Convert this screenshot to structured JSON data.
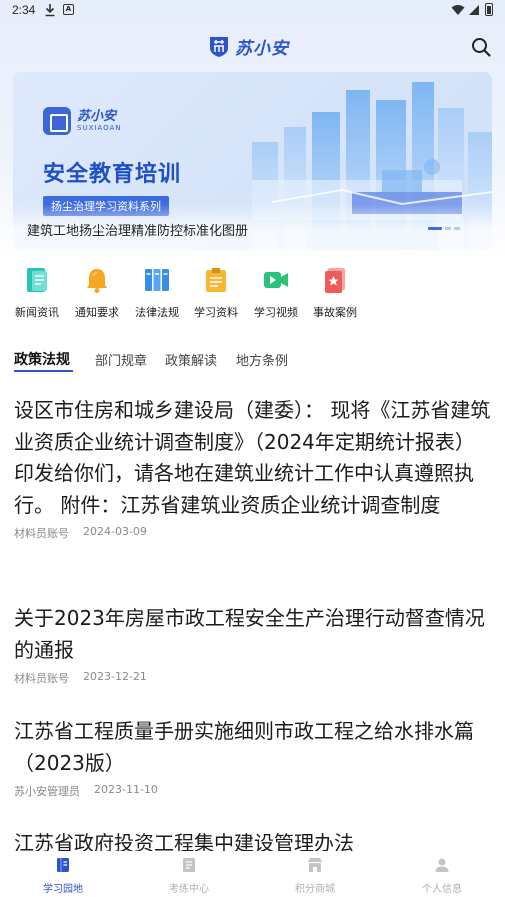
{
  "status_bar": {
    "time": "2:34",
    "a_badge": "A"
  },
  "header": {
    "app_name": "苏小安"
  },
  "banner": {
    "brand_cn": "苏小安",
    "brand_en": "SUXIAOAN",
    "title": "安全教育培训",
    "tag": "扬尘治理学习资料系列",
    "caption": "建筑工地扬尘治理精准防控标准化图册"
  },
  "categories": [
    {
      "label": "新闻资讯",
      "icon": "news-icon",
      "color": "#27c7b8"
    },
    {
      "label": "通知要求",
      "icon": "bell-icon",
      "color": "#f5a623"
    },
    {
      "label": "法律法规",
      "icon": "books-icon",
      "color": "#3a8ee6"
    },
    {
      "label": "学习资料",
      "icon": "clipboard-icon",
      "color": "#f7b733"
    },
    {
      "label": "学习视频",
      "icon": "video-icon",
      "color": "#2bc27a"
    },
    {
      "label": "事故案例",
      "icon": "case-icon",
      "color": "#ef5b5b"
    }
  ],
  "tabs": [
    "政策法规",
    "部门规章",
    "政策解读",
    "地方条例"
  ],
  "articles": [
    {
      "title": "设区市住房和城乡建设局（建委）：  现将《江苏省建筑业资质企业统计调查制度》（2024年定期统计报表）印发给你们，请各地在建筑业统计工作中认真遵照执行。  附件：江苏省建筑业资质企业统计调查制度",
      "author": "材料员账号",
      "date": "2024-03-09"
    },
    {
      "title": "关于2023年房屋市政工程安全生产治理行动督查情况的通报",
      "author": "材料员账号",
      "date": "2023-12-21"
    },
    {
      "title": "江苏省工程质量手册实施细则市政工程之给水排水篇（2023版）",
      "author": "苏小安管理员",
      "date": "2023-11-10"
    },
    {
      "title": "江苏省政府投资工程集中建设管理办法",
      "author": "",
      "date": ""
    }
  ],
  "bottom_nav": [
    {
      "label": "学习园地",
      "icon": "book-icon",
      "active": true
    },
    {
      "label": "考练中心",
      "icon": "exam-icon",
      "active": false
    },
    {
      "label": "积分商城",
      "icon": "shop-icon",
      "active": false
    },
    {
      "label": "个人信息",
      "icon": "user-icon",
      "active": false
    }
  ],
  "colors": {
    "accent": "#2d55c8",
    "meta_text": "#8a8a8a",
    "nav_inactive": "#b0b0b0"
  }
}
